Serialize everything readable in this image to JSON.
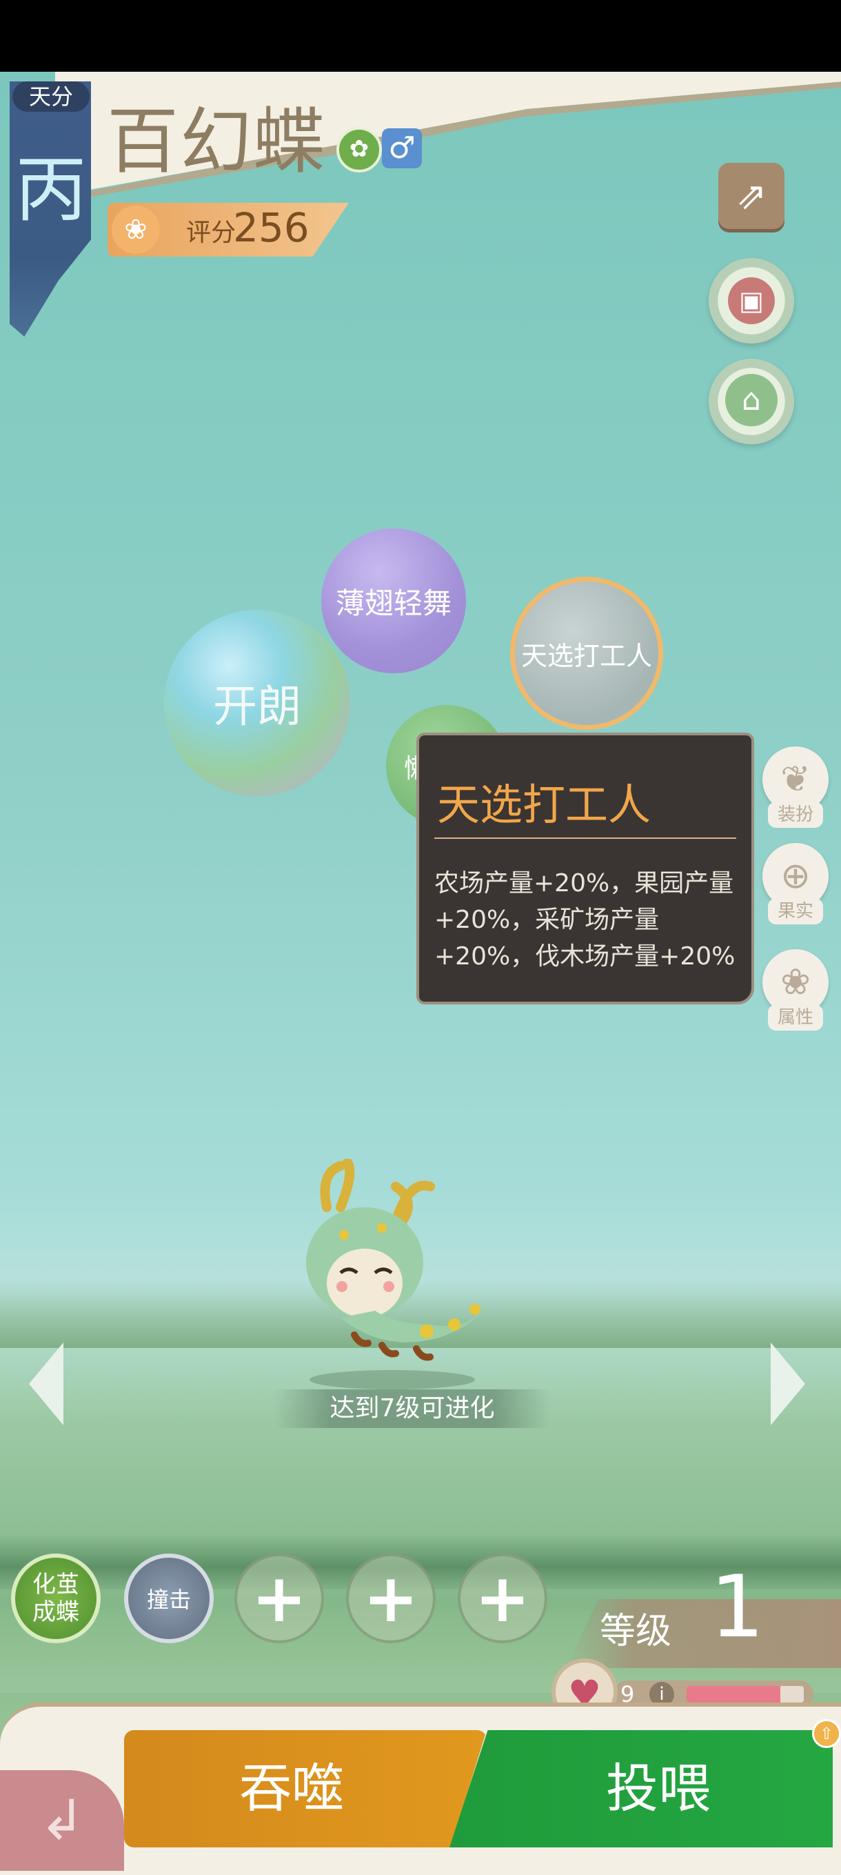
{
  "header": {
    "grade_label": "天分",
    "grade_value": "丙",
    "pet_name": "百幻蝶",
    "element_icon": "leaf-element-icon",
    "gender_symbol": "♂",
    "score_label": "评分",
    "score_value": "256"
  },
  "top_buttons": {
    "share": "share-icon",
    "lock": "lock-icon",
    "house": "house-icon"
  },
  "traits": [
    {
      "label": "开朗"
    },
    {
      "label": "薄翅轻舞"
    },
    {
      "label": "天选打工人",
      "selected": true
    },
    {
      "label": "懒"
    }
  ],
  "tooltip": {
    "title": "天选打工人",
    "description": "农场产量+20%，果园产量+20%，采矿场产量+20%，伐木场产量+20%"
  },
  "side_tabs": [
    {
      "label": "装扮",
      "icon": "butterfly-icon"
    },
    {
      "label": "果实",
      "icon": "plus-icon"
    },
    {
      "label": "属性",
      "icon": "paw-icon"
    }
  ],
  "creature": {
    "evolve_hint": "达到7级可进化"
  },
  "skills": {
    "evolve": "化茧成蝶",
    "strike": "撞击",
    "empty_symbol": "+"
  },
  "level": {
    "label": "等级",
    "value": "1"
  },
  "affinity": {
    "value": "9",
    "fill_percent": 0.8
  },
  "bottom": {
    "devour": "吞噬",
    "feed": "投喂"
  },
  "colors": {
    "devour": "#d48a1c",
    "feed": "#1f9b3b",
    "tooltip_title": "#f2a64a"
  }
}
